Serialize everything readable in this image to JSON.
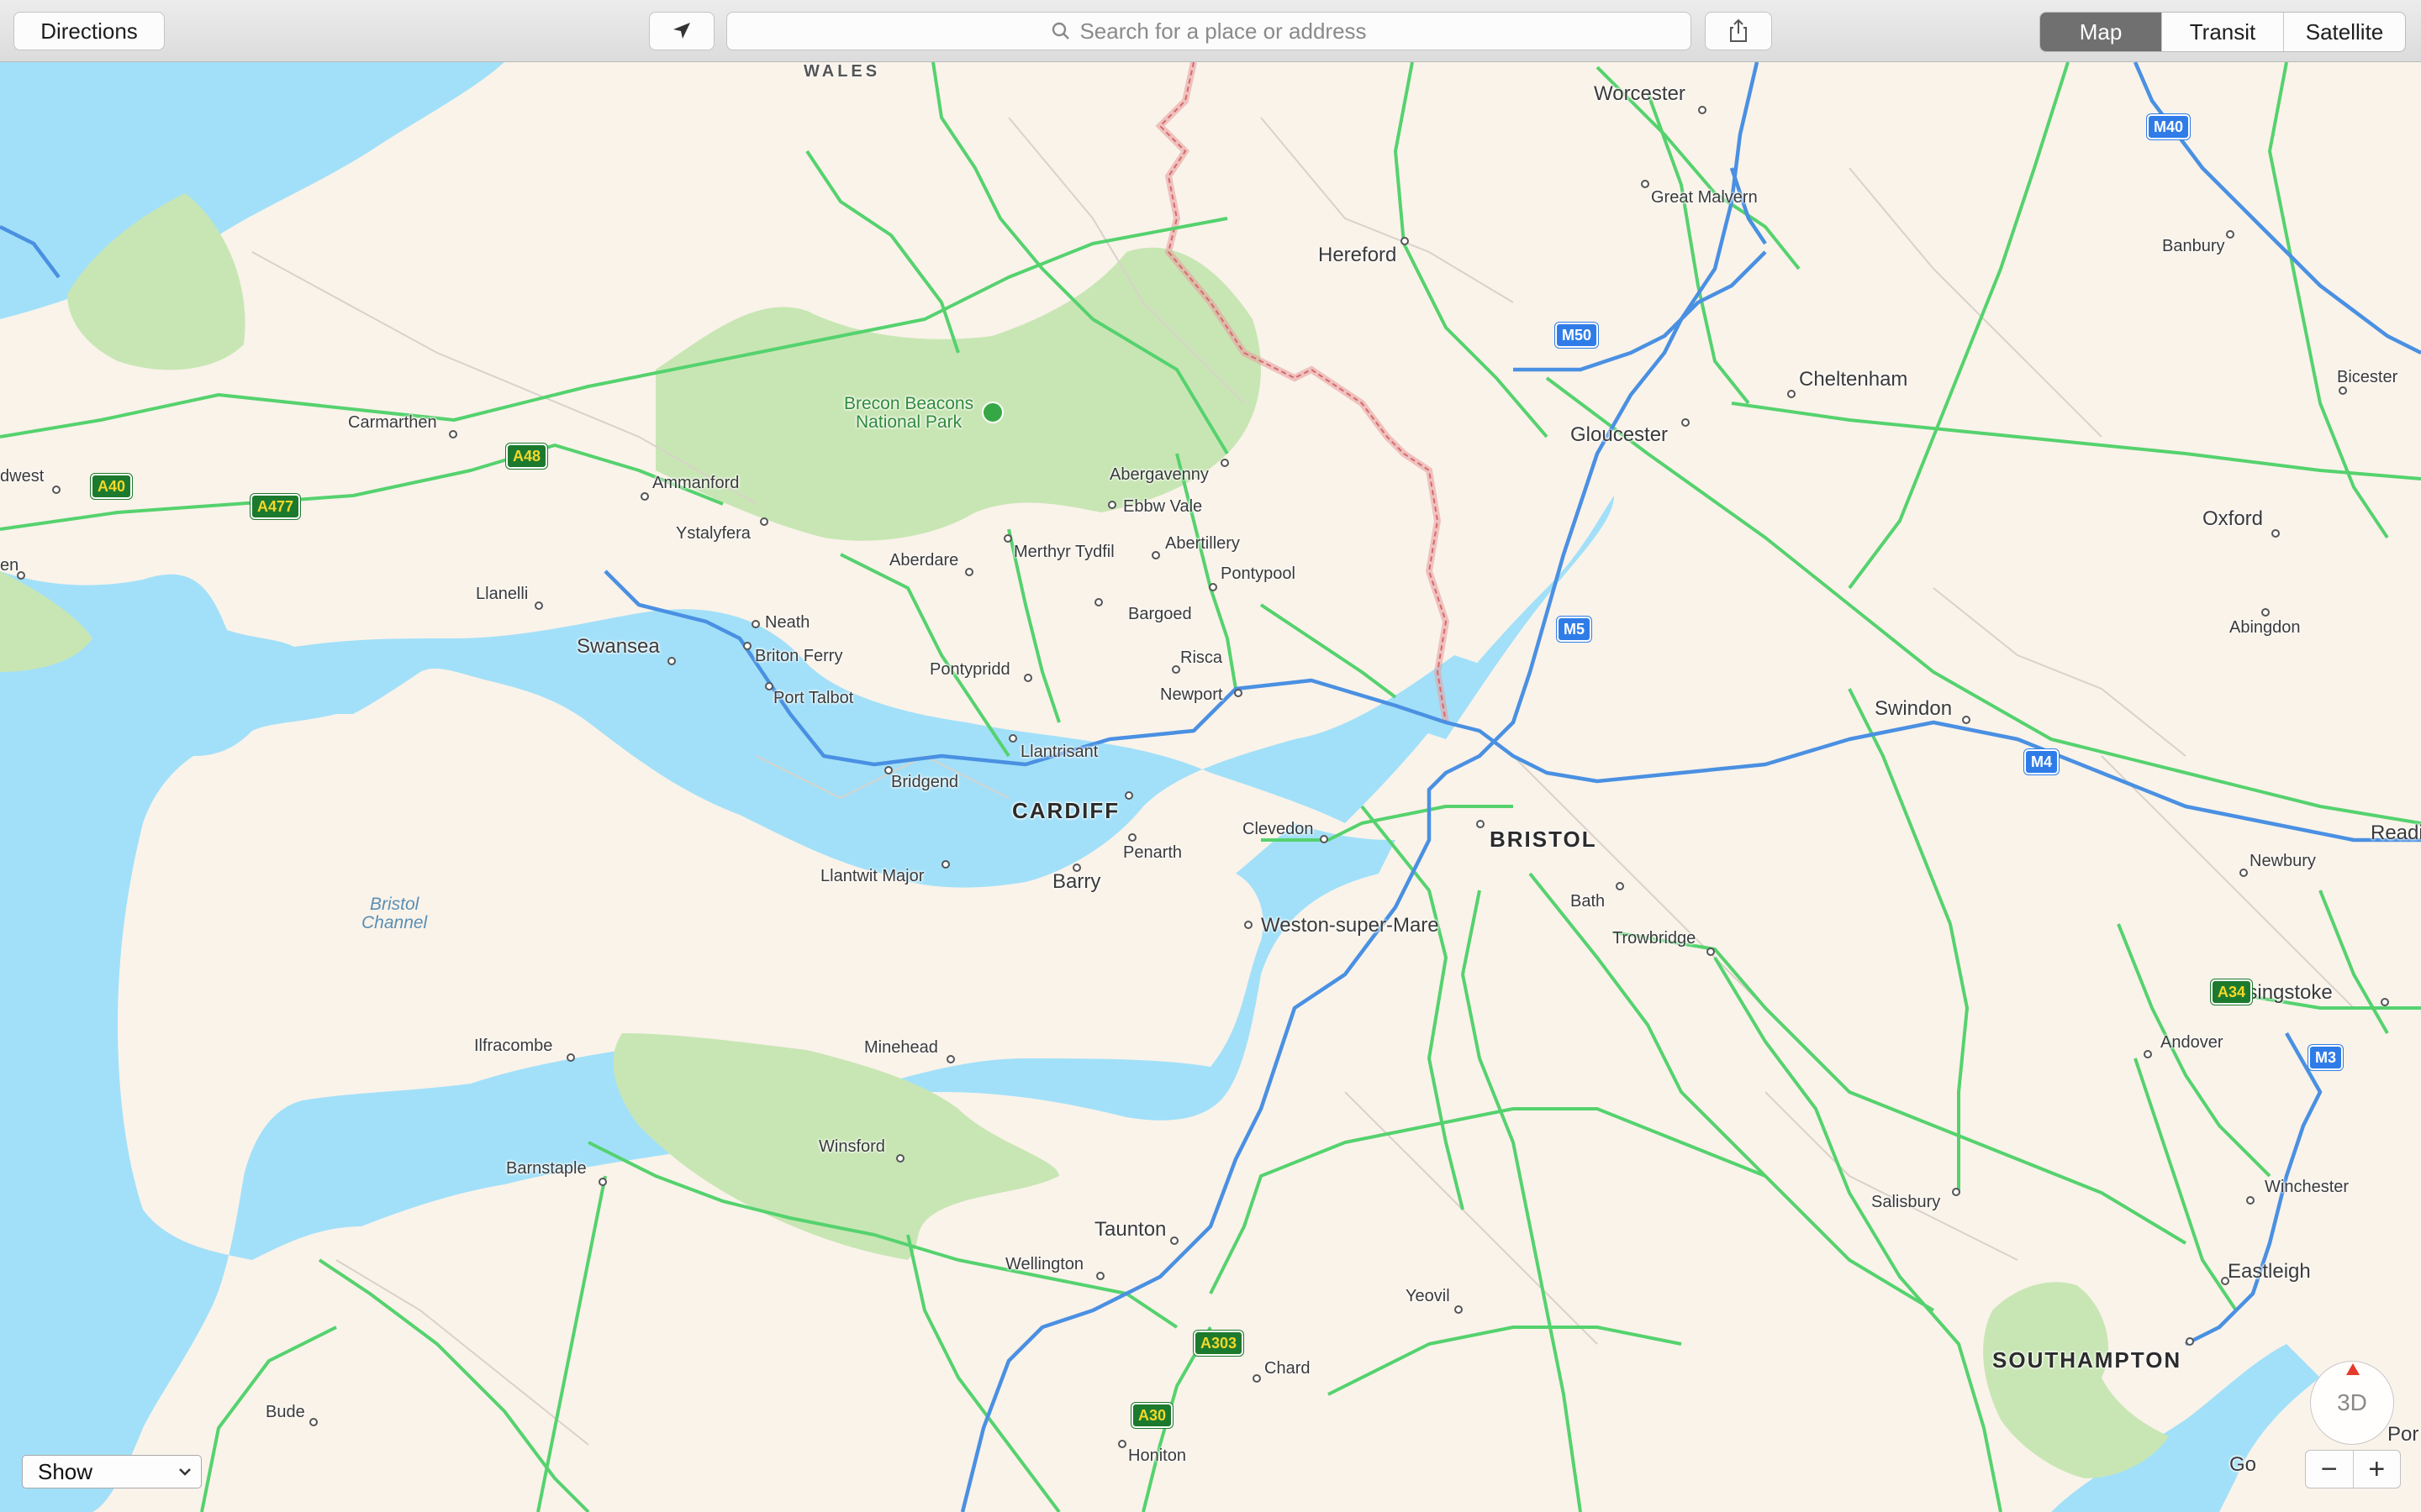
{
  "toolbar": {
    "directions_label": "Directions",
    "search_placeholder": "Search for a place or address",
    "modes": [
      "Map",
      "Transit",
      "Satellite"
    ],
    "active_mode": "Map"
  },
  "map": {
    "region_labels": {
      "wales": "WALES"
    },
    "water_labels": {
      "bristol_channel_1": "Bristol",
      "bristol_channel_2": "Channel"
    },
    "park_labels": {
      "brecon_1": "Brecon Beacons",
      "brecon_2": "National Park"
    },
    "major_cities": {
      "cardiff": "CARDIFF",
      "bristol": "BRISTOL",
      "southampton": "SOUTHAMPTON"
    },
    "places": {
      "worcester": "Worcester",
      "great_malvern": "Great Malvern",
      "hereford": "Hereford",
      "banbury": "Banbury",
      "cheltenham": "Cheltenham",
      "bicester": "Bicester",
      "gloucester": "Gloucester",
      "oxford": "Oxford",
      "abingdon": "Abingdon",
      "carmarthen": "Carmarthen",
      "dwest": "dwest",
      "ammanford": "Ammanford",
      "ystalyfera": "Ystalyfera",
      "abergavenny": "Abergavenny",
      "ebbw_vale": "Ebbw Vale",
      "merthyr": "Merthyr Tydfil",
      "abertillery": "Abertillery",
      "aberdare": "Aberdare",
      "pontypool": "Pontypool",
      "llanelli": "Llanelli",
      "en": "en",
      "neath": "Neath",
      "swansea": "Swansea",
      "briton_ferry": "Briton Ferry",
      "bargoed": "Bargoed",
      "risca": "Risca",
      "pontypridd": "Pontypridd",
      "newport": "Newport",
      "port_talbot": "Port Talbot",
      "llantrisant": "Llantrisant",
      "swindon": "Swindon",
      "bridgend": "Bridgend",
      "clevedon": "Clevedon",
      "penarth": "Penarth",
      "readi": "Readi",
      "newbury": "Newbury",
      "llantwit": "Llantwit Major",
      "barry": "Barry",
      "bath": "Bath",
      "weston": "Weston-super-Mare",
      "trowbridge": "Trowbridge",
      "basingstoke": "Basingstoke",
      "andover": "Andover",
      "ilfracombe": "Ilfracombe",
      "minehead": "Minehead",
      "winsford": "Winsford",
      "barnstaple": "Barnstaple",
      "salisbury": "Salisbury",
      "winchester": "Winchester",
      "taunton": "Taunton",
      "wellington": "Wellington",
      "eastleigh": "Eastleigh",
      "yeovil": "Yeovil",
      "chard": "Chard",
      "bude": "Bude",
      "honiton": "Honiton",
      "go": "Go",
      "por": "Por"
    },
    "road_shields": {
      "m40": "M40",
      "m50": "M50",
      "m5": "M5",
      "m4": "M4",
      "m3": "M3",
      "a48": "A48",
      "a40": "A40",
      "a477": "A477",
      "a34": "A34",
      "a303": "A303",
      "a30": "A30"
    }
  },
  "controls": {
    "show_label": "Show",
    "compass_label": "3D",
    "zoom_out": "−",
    "zoom_in": "+"
  },
  "colors": {
    "land": "#faf3ea",
    "water": "#a2e0f9",
    "park": "#c8e6b4",
    "motorway": "#4a90e2",
    "a_road": "#55d26e",
    "border": "#e8a0a0"
  }
}
